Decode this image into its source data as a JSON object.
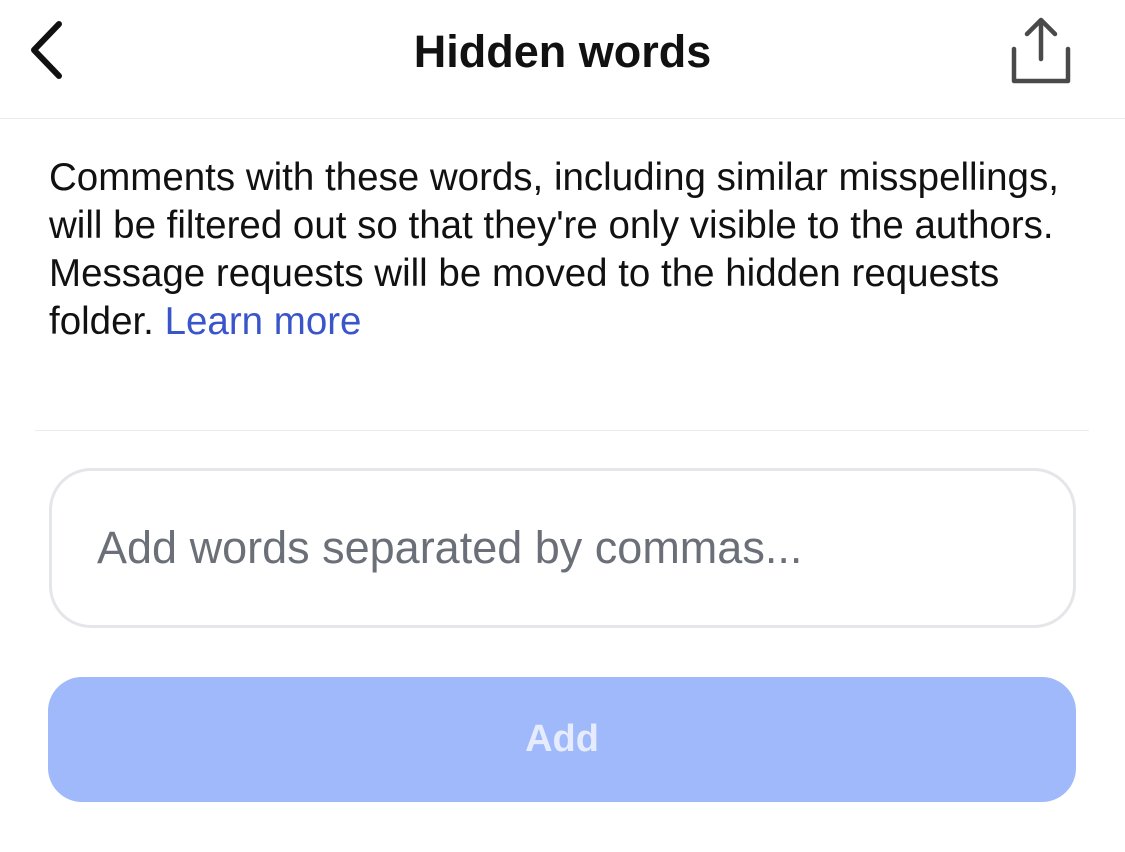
{
  "header": {
    "title": "Hidden words",
    "back_icon": "chevron-left-icon",
    "share_icon": "share-icon"
  },
  "description": {
    "text": "Comments with these words, including similar misspellings, will be filtered out so that they're only visible to the authors. Message requests will be moved to the hidden requests folder.",
    "link_label": "Learn more",
    "link_color": "#3a55c9"
  },
  "input": {
    "value": "",
    "placeholder": "Add words separated by commas..."
  },
  "add_button": {
    "label": "Add",
    "state": "disabled",
    "background": "#9fb9fa"
  }
}
